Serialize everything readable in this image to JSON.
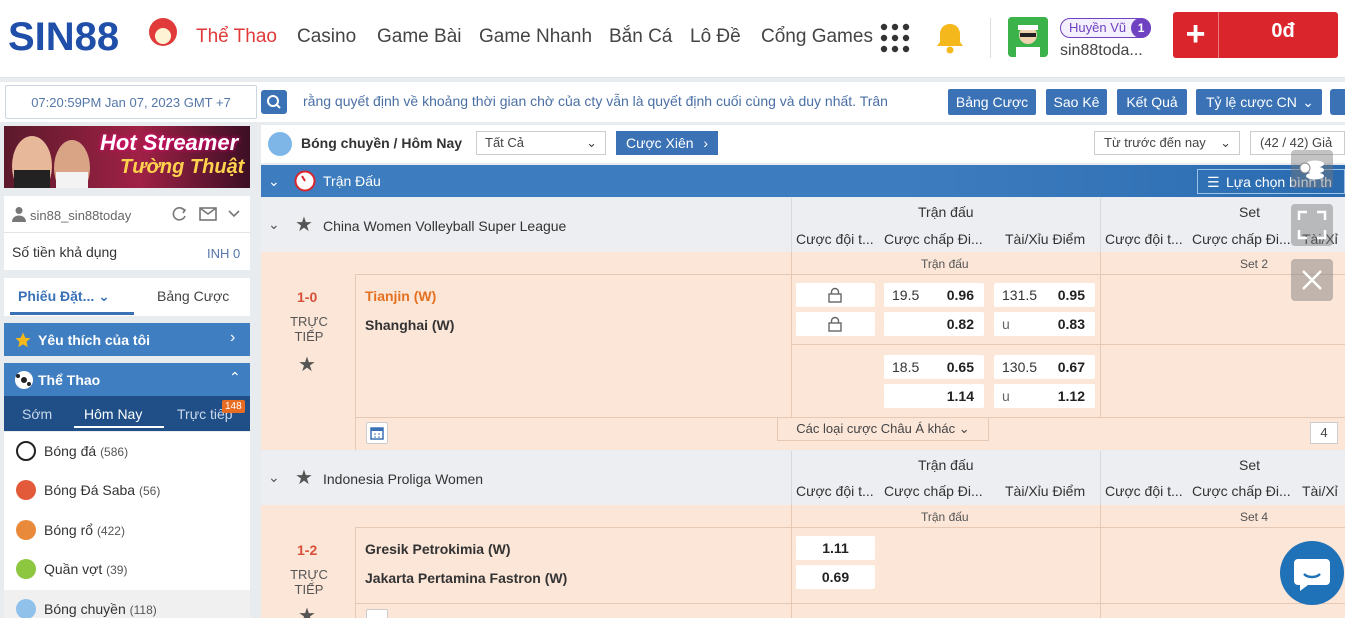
{
  "brand": {
    "logo_text": "SIN88"
  },
  "nav": {
    "items": [
      "Thể Thao",
      "Casino",
      "Game Bài",
      "Game Nhanh",
      "Bắn Cá",
      "Lô Đề",
      "Cổng Games"
    ]
  },
  "user": {
    "vip_name": "Huyền Vũ",
    "vip_level": "1",
    "username": "sin88toda...",
    "balance": "0đ",
    "account_label": "sin88_sin88today",
    "available_label": "Số tiền khả dụng",
    "available_value": "INH 0"
  },
  "topbar": {
    "clock": "07:20:59PM Jan 07, 2023 GMT +7",
    "marquee": "rằng quyết định về khoảng thời gian chờ của cty vẫn là quyết định cuối cùng và duy nhất. Trân",
    "buttons": [
      "Bảng Cược",
      "Sao Kê",
      "Kết Quả",
      "Tỷ lệ cược CN"
    ]
  },
  "sidebar": {
    "banner_line1": "Hot Streamer",
    "banner_line2": "Tường Thuật",
    "tabs": [
      "Phiếu Đặt...",
      "Bảng Cược"
    ],
    "favorites": "Yêu thích của tôi",
    "sports_title": "Thể Thao",
    "sport_tabs": [
      "Sớm",
      "Hôm Nay",
      "Trực tiếp"
    ],
    "live_count": "148",
    "sports": [
      {
        "name": "Bóng đá",
        "count": "(586)"
      },
      {
        "name": "Bóng Đá Saba",
        "count": "(56)"
      },
      {
        "name": "Bóng rổ",
        "count": "(422)"
      },
      {
        "name": "Quần vợt",
        "count": "(39)"
      },
      {
        "name": "Bóng chuyền",
        "count": "(118)"
      }
    ]
  },
  "main": {
    "breadcrumb": "Bóng chuyền / Hôm Nay",
    "filter": "Tất Cả",
    "parlay": "Cược Xiên",
    "date_filter": "Từ trước đến nay",
    "count_text": "(42 / 42) Giả",
    "section_title": "Trận Đấu",
    "choose_btn": "Lựa chọn bình th",
    "col_group1": "Trận đấu",
    "col_group2": "Set",
    "cols": [
      "Cược đội t...",
      "Cược chấp Đi...",
      "Tài/Xỉu Điểm",
      "Cược đội t...",
      "Cược chấp Đi...",
      "Tài/Xỉ"
    ],
    "more_bets": "Các loại cược Châu Á khác",
    "more_count": "4"
  },
  "leagues": [
    {
      "name": "China Women Volleyball Super League",
      "sub_left": "Trận đấu",
      "sub_right": "Set 2",
      "score": "1-0",
      "status": "TRỰC TIẾP",
      "home": "Tianjin (W)",
      "away": "Shanghai (W)",
      "hdp1_h": "19.5",
      "hdp1_hv": "0.96",
      "hdp1_av": "0.82",
      "ou1_h": "131.5",
      "ou1_hv": "0.95",
      "ou1_a": "u",
      "ou1_av": "0.83",
      "hdp2_h": "18.5",
      "hdp2_hv": "0.65",
      "hdp2_av": "1.14",
      "ou2_h": "130.5",
      "ou2_hv": "0.67",
      "ou2_a": "u",
      "ou2_av": "1.12"
    },
    {
      "name": "Indonesia Proliga Women",
      "sub_left": "Trận đấu",
      "sub_right": "Set 4",
      "score": "1-2",
      "status": "TRỰC TIẾP",
      "home": "Gresik Petrokimia (W)",
      "away": "Jakarta Pertamina Fastron (W)",
      "ml_home": "1.11",
      "ml_away": "0.69"
    }
  ],
  "colors": {
    "accent": "#3a72b5",
    "brand_red": "#d9252b",
    "match_bg": "#fbe6d8",
    "fav_team": "#e5701f"
  }
}
